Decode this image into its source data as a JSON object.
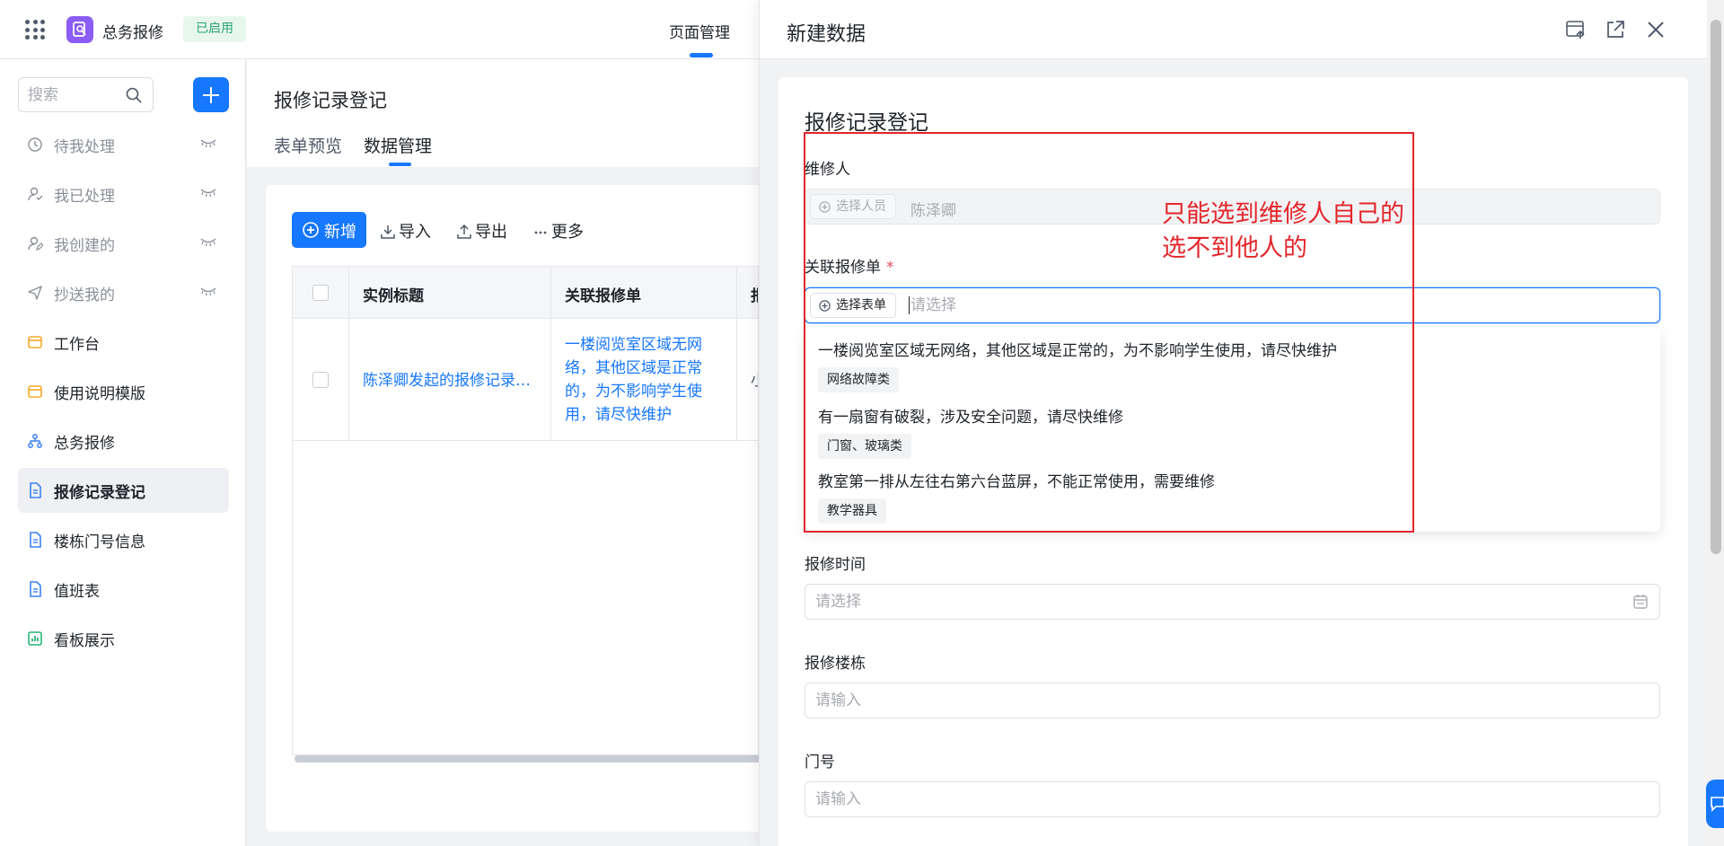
{
  "header": {
    "app_name": "总务报修",
    "status_badge": "已启用",
    "tab": "页面管理"
  },
  "sidebar": {
    "search_placeholder": "搜索",
    "items": [
      {
        "label": "待我处理",
        "icon": "clock-icon"
      },
      {
        "label": "我已处理",
        "icon": "user-check-icon"
      },
      {
        "label": "我创建的",
        "icon": "user-edit-icon"
      },
      {
        "label": "抄送我的",
        "icon": "send-icon"
      },
      {
        "label": "工作台",
        "icon": "workspace-icon"
      },
      {
        "label": "使用说明模版",
        "icon": "folder-icon"
      },
      {
        "label": "总务报修",
        "icon": "flow-icon"
      },
      {
        "label": "报修记录登记",
        "icon": "form-icon"
      },
      {
        "label": "楼栋门号信息",
        "icon": "form-icon"
      },
      {
        "label": "值班表",
        "icon": "form-icon"
      },
      {
        "label": "看板展示",
        "icon": "dashboard-icon"
      }
    ]
  },
  "main": {
    "title": "报修记录登记",
    "tabs": [
      "表单预览",
      "数据管理"
    ],
    "active_tab": "数据管理",
    "toolbar": {
      "new_label": "新增",
      "import_label": "导入",
      "export_label": "导出",
      "more_label": "更多"
    },
    "table": {
      "columns": [
        "实例标题",
        "关联报修单",
        "报"
      ],
      "rows": [
        {
          "title": "陈泽卿发起的报修记录登记",
          "order": "一楼阅览室区域无网络，其他区域是正常的，为不影响学生使用，请尽快维护",
          "clip": "小"
        }
      ]
    }
  },
  "drawer": {
    "title": "新建数据",
    "form_title": "报修记录登记",
    "fields": {
      "repairer": {
        "label": "维修人",
        "button": "选择人员",
        "value": "陈泽卿"
      },
      "related_order": {
        "label": "关联报修单",
        "required": "*",
        "button": "选择表单",
        "placeholder": "请选择"
      },
      "repair_time": {
        "label": "报修时间",
        "placeholder": "请选择"
      },
      "building": {
        "label": "报修楼栋",
        "placeholder": "请输入"
      },
      "door": {
        "label": "门号",
        "placeholder": "请输入"
      }
    },
    "options": [
      {
        "text": "一楼阅览室区域无网络，其他区域是正常的，为不影响学生使用，请尽快维护",
        "tag": "网络故障类"
      },
      {
        "text": "有一扇窗有破裂，涉及安全问题，请尽快维修",
        "tag": "门窗、玻璃类"
      },
      {
        "text": "教室第一排从左往右第六台蓝屏，不能正常使用，需要维修",
        "tag": "教学器具"
      }
    ]
  },
  "annotation": {
    "line1": "只能选到维修人自己的",
    "line2": "选不到他人的",
    "color": "#e3262b"
  },
  "colors": {
    "primary": "#1677ff",
    "status_green": "#2ba471",
    "app_logo": "#8b5cf6"
  }
}
